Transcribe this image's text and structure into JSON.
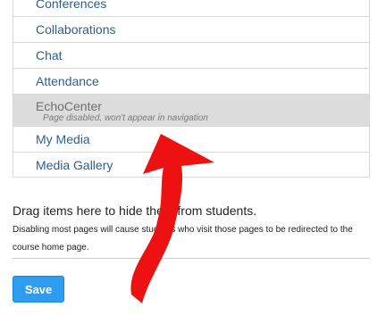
{
  "nav": {
    "items": [
      {
        "label": "Conferences"
      },
      {
        "label": "Collaborations"
      },
      {
        "label": "Chat"
      },
      {
        "label": "Attendance"
      },
      {
        "label": "EchoCenter",
        "note": "Page disabled, won't appear in navigation"
      },
      {
        "label": "My Media"
      },
      {
        "label": "Media Gallery"
      }
    ]
  },
  "hidden_section": {
    "title": "Drag items here to hide them from students.",
    "description": "Disabling most pages will cause students who visit those pages to be redirected to the course home page."
  },
  "actions": {
    "save_label": "Save"
  },
  "colors": {
    "link": "#2d5f8a",
    "disabled_bg": "#dcdcdc",
    "save_button": "#2e9cf0",
    "annotation_arrow": "#ee1111"
  }
}
